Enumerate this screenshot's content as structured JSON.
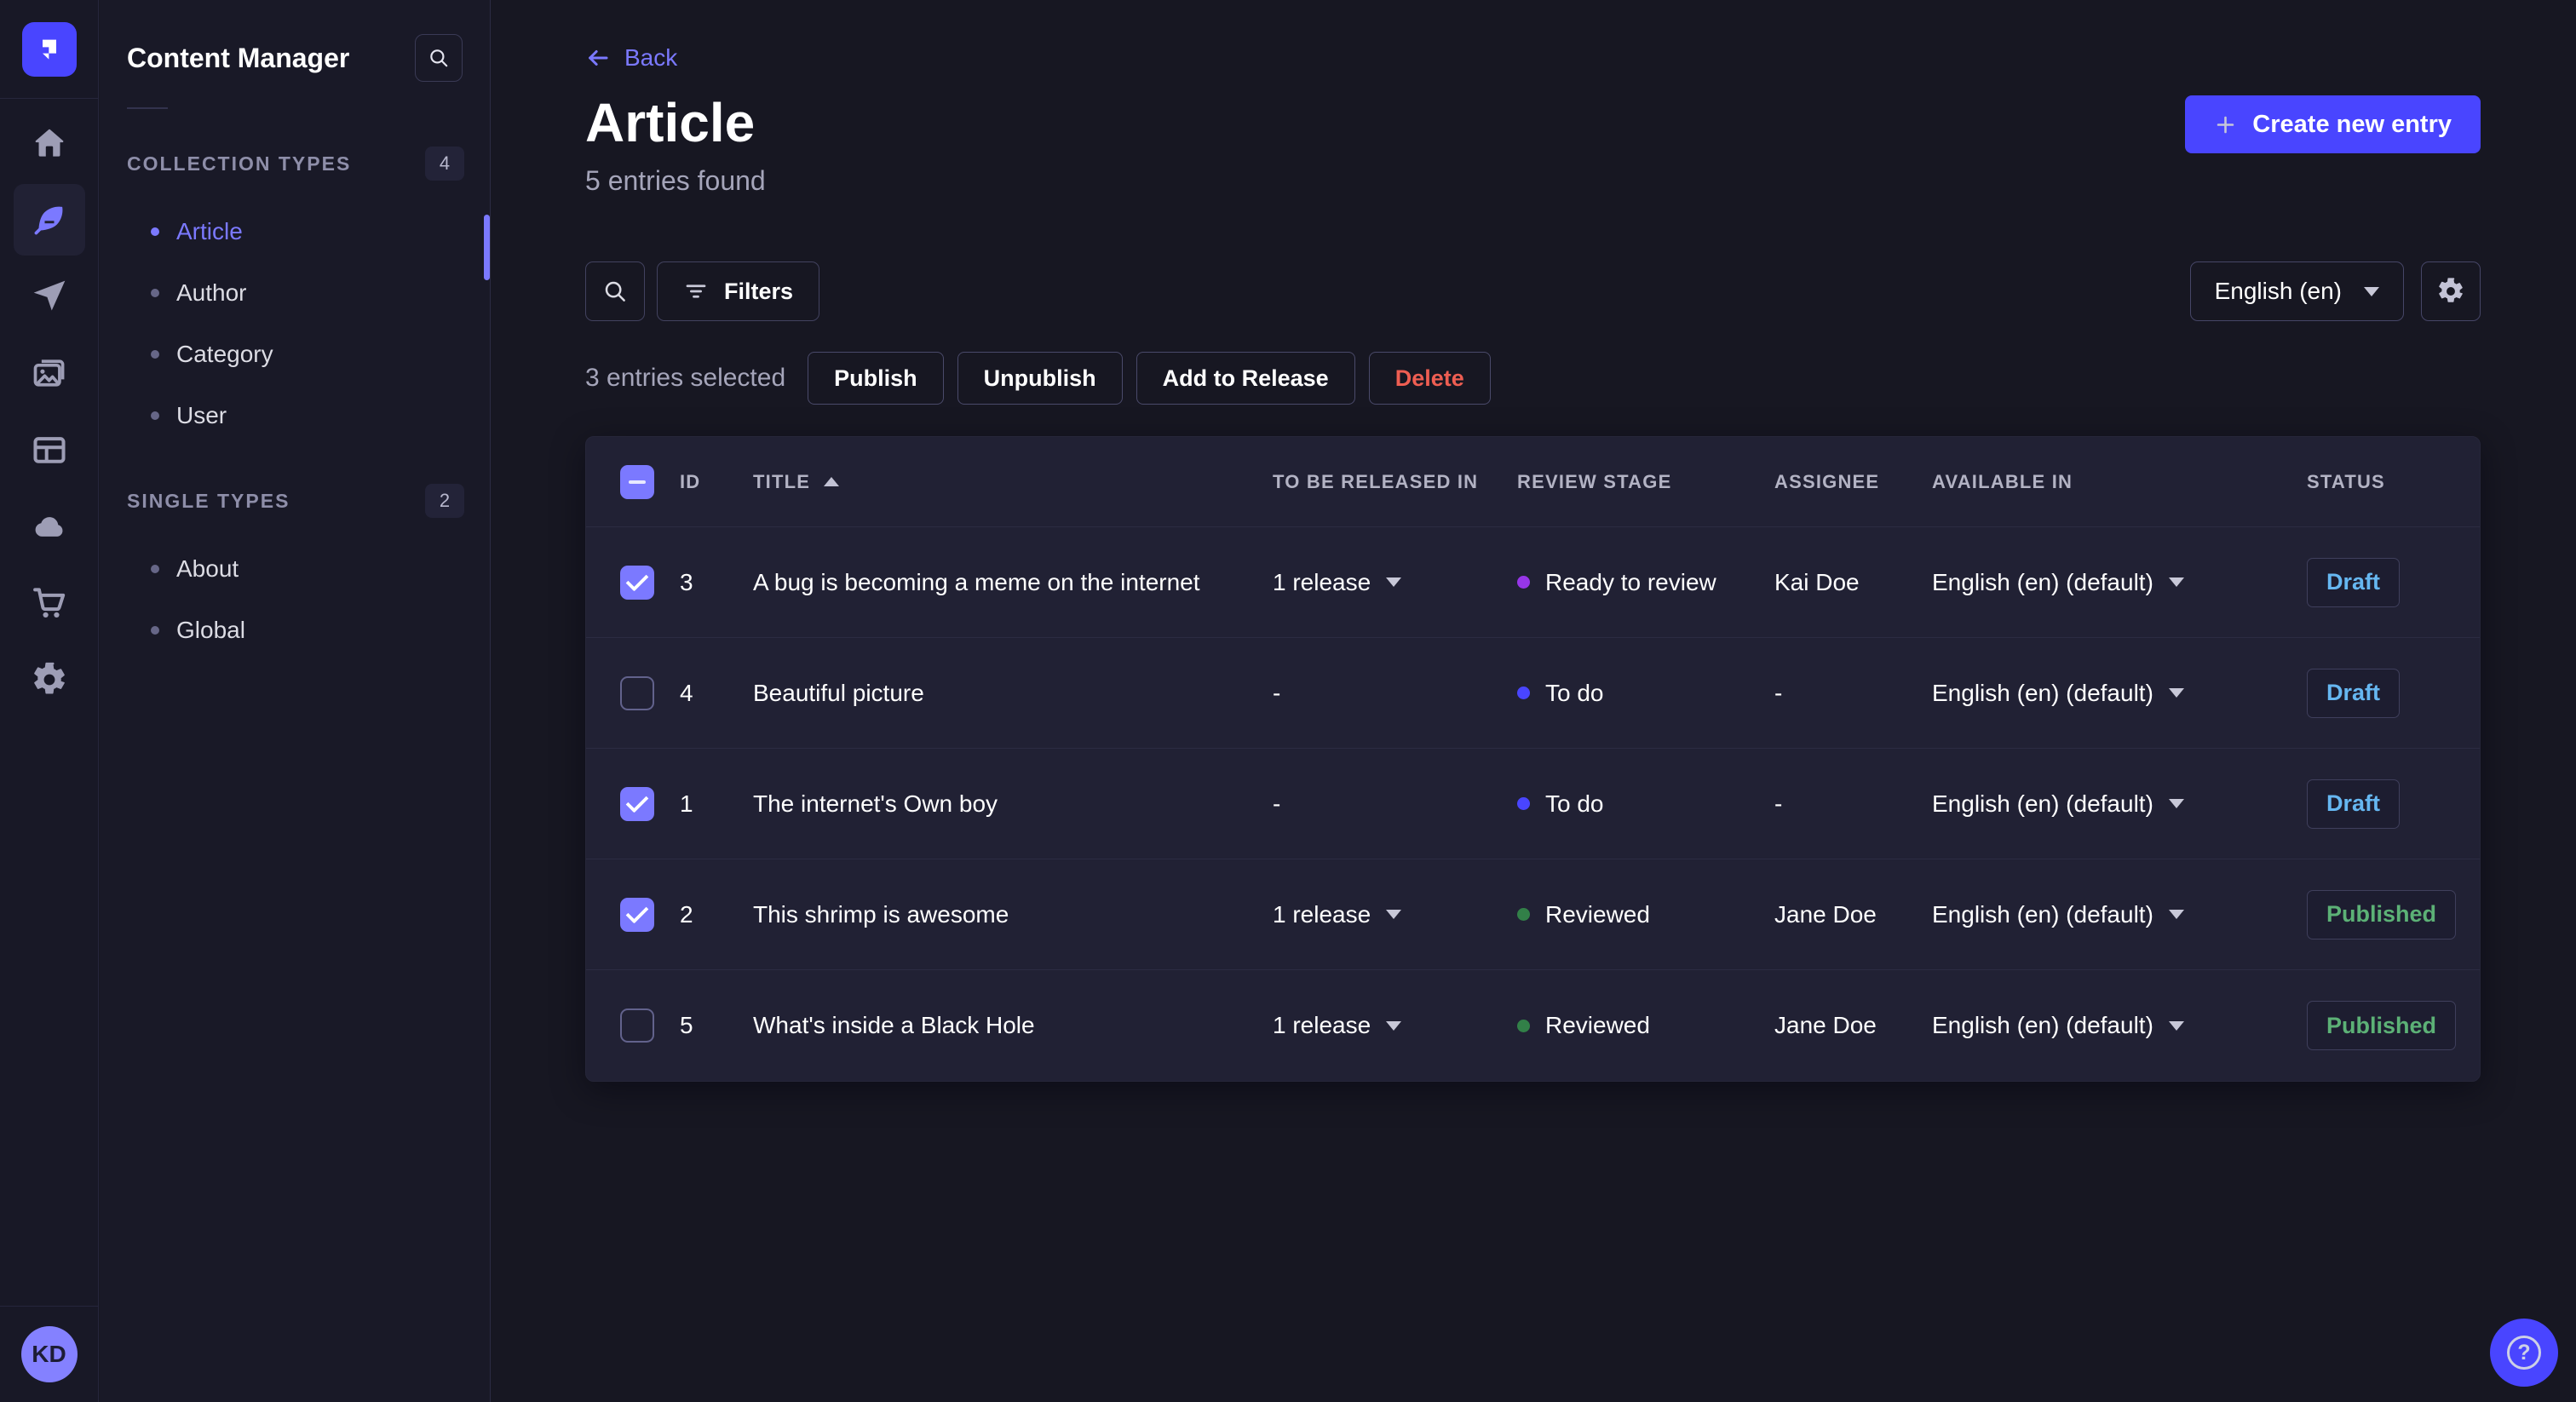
{
  "app": {
    "name": "Strapi admin",
    "accent_color": "#4945ff",
    "link_color": "#7b79ff"
  },
  "nav_rail": {
    "icons": [
      "home-icon",
      "content-manager-feather-icon",
      "send-plane-icon",
      "media-library-icon",
      "content-type-builder-icon",
      "cloud-icon",
      "marketplace-cart-icon",
      "settings-gear-icon"
    ],
    "active_icon": "content-manager-feather-icon",
    "avatar_initials": "KD"
  },
  "sidebar": {
    "title": "Content Manager",
    "sections": [
      {
        "label": "COLLECTION TYPES",
        "count": "4",
        "items": [
          {
            "label": "Article",
            "active": "active"
          },
          {
            "label": "Author",
            "active": ""
          },
          {
            "label": "Category",
            "active": ""
          },
          {
            "label": "User",
            "active": ""
          }
        ]
      },
      {
        "label": "SINGLE TYPES",
        "count": "2",
        "items": [
          {
            "label": "About",
            "active": ""
          },
          {
            "label": "Global",
            "active": ""
          }
        ]
      }
    ]
  },
  "header": {
    "back_label": "Back",
    "title": "Article",
    "subtitle": "5 entries found",
    "create_button_label": "Create new entry"
  },
  "toolbar": {
    "filters_label": "Filters",
    "locale_value": "English (en)"
  },
  "bulk_actions": {
    "selected_text": "3 entries selected",
    "publish_label": "Publish",
    "unpublish_label": "Unpublish",
    "add_to_release_label": "Add to Release",
    "delete_label": "Delete"
  },
  "table": {
    "columns": {
      "id": "ID",
      "title": "TITLE",
      "release": "TO BE RELEASED IN",
      "review": "REVIEW STAGE",
      "assignee": "ASSIGNEE",
      "available": "AVAILABLE IN",
      "status": "STATUS"
    },
    "header_check_state": "indeterminate",
    "sort_column": "TITLE",
    "sort_direction": "ascending",
    "rows": [
      {
        "check": "checked",
        "id": "3",
        "title": "A bug is becoming a meme on the internet",
        "release": "1 release",
        "release_caret": "caret-show",
        "review_label": "Ready to review",
        "review_color": "#9736e8",
        "assignee": "Kai Doe",
        "available": "English (en) (default)",
        "status_label": "Draft",
        "status_color": "#66b7f1"
      },
      {
        "check": "unchecked",
        "id": "4",
        "title": "Beautiful picture",
        "release": "-",
        "release_caret": "caret-hide",
        "review_label": "To do",
        "review_color": "#4945ff",
        "assignee": "-",
        "available": "English (en) (default)",
        "status_label": "Draft",
        "status_color": "#66b7f1"
      },
      {
        "check": "checked",
        "id": "1",
        "title": "The internet's Own boy",
        "release": "-",
        "release_caret": "caret-hide",
        "review_label": "To do",
        "review_color": "#4945ff",
        "assignee": "-",
        "available": "English (en) (default)",
        "status_label": "Draft",
        "status_color": "#66b7f1"
      },
      {
        "check": "checked",
        "id": "2",
        "title": "This shrimp is awesome",
        "release": "1 release",
        "release_caret": "caret-show",
        "review_label": "Reviewed",
        "review_color": "#328048",
        "assignee": "Jane Doe",
        "available": "English (en) (default)",
        "status_label": "Published",
        "status_color": "#5cb176"
      },
      {
        "check": "unchecked",
        "id": "5",
        "title": "What's inside a Black Hole",
        "release": "1 release",
        "release_caret": "caret-show",
        "review_label": "Reviewed",
        "review_color": "#328048",
        "assignee": "Jane Doe",
        "available": "English (en) (default)",
        "status_label": "Published",
        "status_color": "#5cb176"
      }
    ]
  },
  "status_colors": {
    "draft": "#66b7f1",
    "published": "#5cb176",
    "danger": "#ee5e52"
  }
}
